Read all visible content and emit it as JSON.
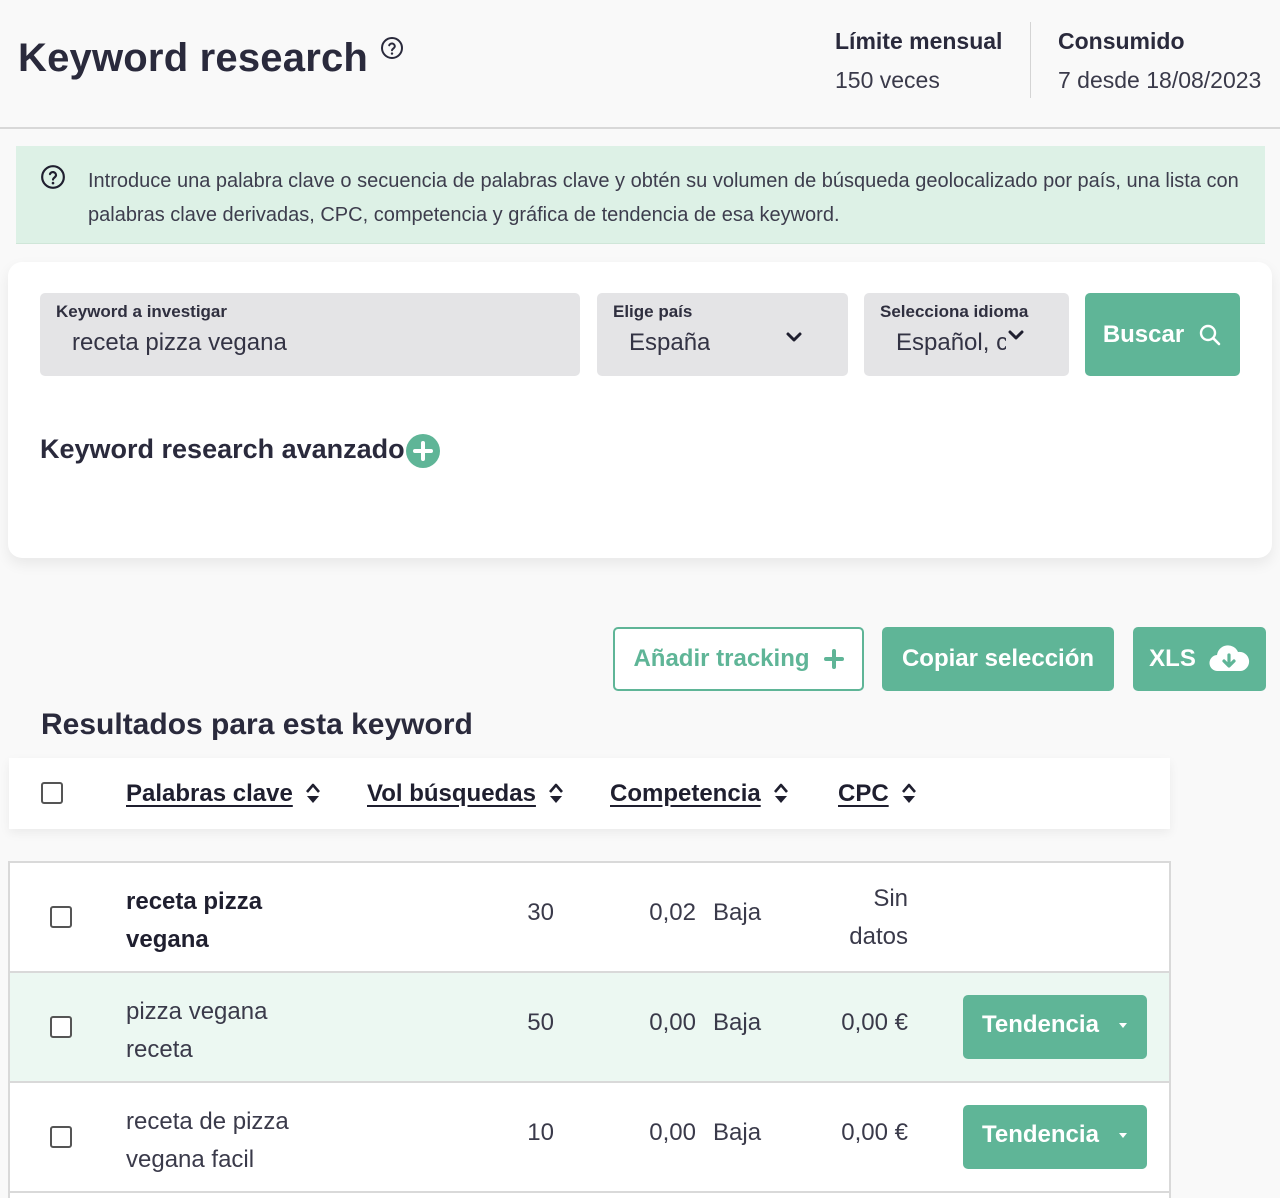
{
  "header": {
    "title": "Keyword research",
    "limit_label": "Límite mensual",
    "limit_value": "150 veces",
    "used_label": "Consumido",
    "used_value": "7 desde 18/08/2023"
  },
  "info": {
    "text": "Introduce una palabra clave o secuencia de palabras clave y obtén su volumen de búsqueda geolocalizado por país, una lista con palabras clave derivadas, CPC, competencia y gráfica de tendencia de esa keyword."
  },
  "search": {
    "keyword_label": "Keyword a investigar",
    "keyword_value": "receta pizza vegana",
    "country_label": "Elige país",
    "country_value": "España",
    "language_label": "Selecciona idioma",
    "language_value": "Español, c",
    "search_button": "Buscar",
    "advanced_label": "Keyword research avanzado"
  },
  "actions": {
    "add_tracking": "Añadir tracking",
    "copy_selection": "Copiar selección",
    "xls": "XLS"
  },
  "results": {
    "title": "Resultados para esta keyword",
    "columns": {
      "keywords": "Palabras clave",
      "volume": "Vol búsquedas",
      "competition": "Competencia",
      "cpc": "CPC"
    },
    "rows": [
      {
        "keyword_line1": "receta pizza",
        "keyword_line2": "vegana",
        "volume": "30",
        "competition_value": "0,02",
        "competition_label": "Baja",
        "cpc_line1": "Sin",
        "cpc_line2": "datos"
      },
      {
        "keyword_line1": "pizza vegana",
        "keyword_line2": "receta",
        "volume": "50",
        "competition_value": "0,00",
        "competition_label": "Baja",
        "cpc": "0,00 €",
        "trend_button": "Tendencia"
      },
      {
        "keyword_line1": "receta de pizza",
        "keyword_line2": "vegana facil",
        "volume": "10",
        "competition_value": "0,00",
        "competition_label": "Baja",
        "cpc": "0,00 €",
        "trend_button": "Tendencia"
      }
    ]
  },
  "colors": {
    "accent": "#5fb597",
    "banner_bg": "#ddf1e6",
    "row_highlight": "#ecf8f2",
    "text_dark": "#2a2a3c"
  },
  "icons": {
    "title_help": "question-circle-icon",
    "info": "question-circle-icon",
    "dropdown": "chevron-down-icon",
    "search": "magnifier-icon",
    "advanced": "plus-circle-icon",
    "tracking": "plus-icon",
    "xls": "cloud-download-icon",
    "sort": "sort-updown-icon",
    "trend_caret": "caret-down-icon"
  }
}
